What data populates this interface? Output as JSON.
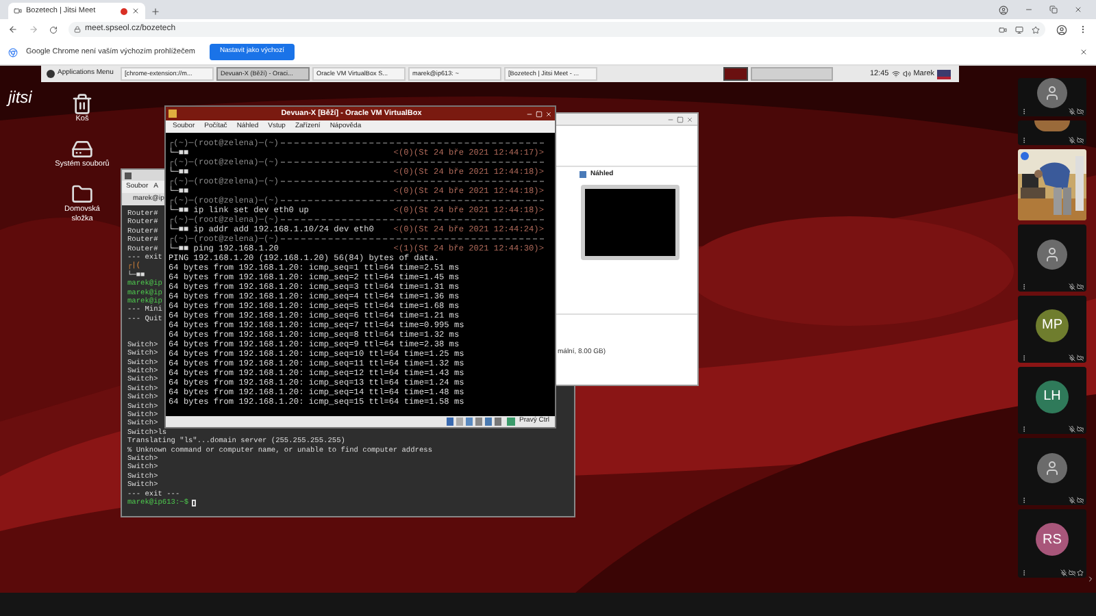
{
  "browser": {
    "tab": {
      "title": "Bozetech | Jitsi Meet",
      "recording": true
    },
    "url": "meet.spseol.cz/bozetech",
    "infobar": {
      "message": "Google Chrome není vaším výchozím prohlížečem",
      "button": "Nastavit jako výchozí"
    }
  },
  "panel": {
    "menu": "Applications Menu",
    "tasks": [
      {
        "label": "[chrome-extension://m...",
        "selected": false
      },
      {
        "label": "Devuan-X (Běží) - Oraci...",
        "selected": true
      },
      {
        "label": "Oracle VM VirtualBox S...",
        "selected": false
      },
      {
        "label": "marek@ip613: ~",
        "selected": false
      },
      {
        "label": "[Bozetech | Jitsi Meet - ...",
        "selected": false
      }
    ],
    "clock": "12:45",
    "user": "Marek"
  },
  "jitsi": {
    "logo": "jitsi"
  },
  "desktop_icons": [
    {
      "label": "Koš",
      "kind": "trash"
    },
    {
      "label": "Systém souborů",
      "kind": "drive"
    },
    {
      "label": "Domovská složka",
      "kind": "folder"
    }
  ],
  "terminal": {
    "menu": [
      "Soubor",
      "A"
    ],
    "tab": "marek@ip",
    "lines": [
      {
        "kind": "plain",
        "text": "Router#"
      },
      {
        "kind": "plain",
        "text": "Router#"
      },
      {
        "kind": "plain",
        "text": "Router#"
      },
      {
        "kind": "plain",
        "text": "Router#"
      },
      {
        "kind": "plain",
        "text": "Router#"
      },
      {
        "kind": "plain",
        "text": "--- exit"
      },
      {
        "kind": "accent",
        "text": "┌|("
      },
      {
        "kind": "plain",
        "text": "└─■■"
      },
      {
        "kind": "user",
        "text": "marek@ip"
      },
      {
        "kind": "user",
        "text": "marek@ip"
      },
      {
        "kind": "user",
        "text": "marek@ip"
      },
      {
        "kind": "plain",
        "text": "--- Mini"
      },
      {
        "kind": "plain",
        "text": "--- Quit"
      },
      {
        "kind": "gap"
      },
      {
        "kind": "gap"
      },
      {
        "kind": "plain",
        "text": "Switch>"
      },
      {
        "kind": "plain",
        "text": "Switch>"
      },
      {
        "kind": "plain",
        "text": "Switch>"
      },
      {
        "kind": "plain",
        "text": "Switch>"
      },
      {
        "kind": "plain",
        "text": "Switch>"
      },
      {
        "kind": "plain",
        "text": "Switch>"
      },
      {
        "kind": "plain",
        "text": "Switch>"
      },
      {
        "kind": "plain",
        "text": "Switch>"
      },
      {
        "kind": "plain",
        "text": "Switch>"
      },
      {
        "kind": "plain",
        "text": "Switch>"
      },
      {
        "kind": "plain",
        "text": "Switch>ls"
      },
      {
        "kind": "plain",
        "text": "Translating \"ls\"...domain server (255.255.255.255)"
      },
      {
        "kind": "plain",
        "text": "% Unknown command or computer name, or unable to find computer address"
      },
      {
        "kind": "plain",
        "text": "Switch>"
      },
      {
        "kind": "plain",
        "text": "Switch>"
      },
      {
        "kind": "plain",
        "text": "Switch>"
      },
      {
        "kind": "plain",
        "text": "Switch>"
      },
      {
        "kind": "plain",
        "text": "--- exit ---"
      },
      {
        "kind": "prompt",
        "text": "marek@ip613:~$"
      }
    ]
  },
  "vm": {
    "title": "Devuan-X [Běží] - Oracle VM VirtualBox",
    "menu": [
      "Soubor",
      "Počítač",
      "Náhled",
      "Vstup",
      "Zařízení",
      "Nápověda"
    ],
    "prompts": [
      {
        "header": "┌(~)─(root@zelena)─(~)",
        "command": "└─■■",
        "time": "<(0)(St 24 bře 2021 12:44:17)>"
      },
      {
        "header": "┌(~)─(root@zelena)─(~)",
        "command": "└─■■",
        "time": "<(0)(St 24 bře 2021 12:44:18)>"
      },
      {
        "header": "┌(~)─(root@zelena)─(~)",
        "command": "└─■■",
        "time": "<(0)(St 24 bře 2021 12:44:18)>"
      },
      {
        "header": "┌(~)─(root@zelena)─(~)",
        "command": "└─■■ ip link set dev eth0 up",
        "time": "<(0)(St 24 bře 2021 12:44:18)>"
      },
      {
        "header": "┌(~)─(root@zelena)─(~)",
        "command": "└─■■ ip addr add 192.168.1.10/24 dev eth0",
        "time": "<(0)(St 24 bře 2021 12:44:24)>"
      },
      {
        "header": "┌(~)─(root@zelena)─(~)",
        "command": "└─■■ ping 192.168.1.20",
        "time": "<(1)(St 24 bře 2021 12:44:30)>"
      }
    ],
    "output": [
      "PING 192.168.1.20 (192.168.1.20) 56(84) bytes of data.",
      "64 bytes from 192.168.1.20: icmp_seq=1 ttl=64 time=2.51 ms",
      "64 bytes from 192.168.1.20: icmp_seq=2 ttl=64 time=1.45 ms",
      "64 bytes from 192.168.1.20: icmp_seq=3 ttl=64 time=1.31 ms",
      "64 bytes from 192.168.1.20: icmp_seq=4 ttl=64 time=1.36 ms",
      "64 bytes from 192.168.1.20: icmp_seq=5 ttl=64 time=1.68 ms",
      "64 bytes from 192.168.1.20: icmp_seq=6 ttl=64 time=1.21 ms",
      "64 bytes from 192.168.1.20: icmp_seq=7 ttl=64 time=0.995 ms",
      "64 bytes from 192.168.1.20: icmp_seq=8 ttl=64 time=1.32 ms",
      "64 bytes from 192.168.1.20: icmp_seq=9 ttl=64 time=2.38 ms",
      "64 bytes from 192.168.1.20: icmp_seq=10 ttl=64 time=1.25 ms",
      "64 bytes from 192.168.1.20: icmp_seq=11 ttl=64 time=1.32 ms",
      "64 bytes from 192.168.1.20: icmp_seq=12 ttl=64 time=1.43 ms",
      "64 bytes from 192.168.1.20: icmp_seq=13 ttl=64 time=1.24 ms",
      "64 bytes from 192.168.1.20: icmp_seq=14 ttl=64 time=1.48 ms",
      "64 bytes from 192.168.1.20: icmp_seq=15 ttl=64 time=1.58 ms"
    ],
    "status": "Pravý Ctrl"
  },
  "manager": {
    "preview_label": "Náhled",
    "detail": "mální, 8.00 GB)"
  },
  "filmstrip": [
    {
      "kind": "avatar",
      "mic_off": true,
      "camera_off": true,
      "starred": false
    },
    {
      "kind": "partial",
      "color": "#9a6a3a",
      "mic_off": true,
      "camera_off": true,
      "starred": false
    },
    {
      "kind": "video",
      "mic_off": false,
      "camera_off": false,
      "starred": false
    },
    {
      "kind": "avatar",
      "mic_off": true,
      "camera_off": true,
      "starred": false
    },
    {
      "kind": "initials",
      "initials": "MP",
      "color": "#6f7d2e",
      "mic_off": true,
      "camera_off": true,
      "starred": false
    },
    {
      "kind": "initials",
      "initials": "LH",
      "color": "#2f7a5a",
      "mic_off": true,
      "camera_off": true,
      "starred": false
    },
    {
      "kind": "avatar",
      "mic_off": true,
      "camera_off": true,
      "starred": false
    },
    {
      "kind": "initials",
      "initials": "RS",
      "color": "#a8567a",
      "mic_off": true,
      "camera_off": true,
      "starred": true
    }
  ]
}
